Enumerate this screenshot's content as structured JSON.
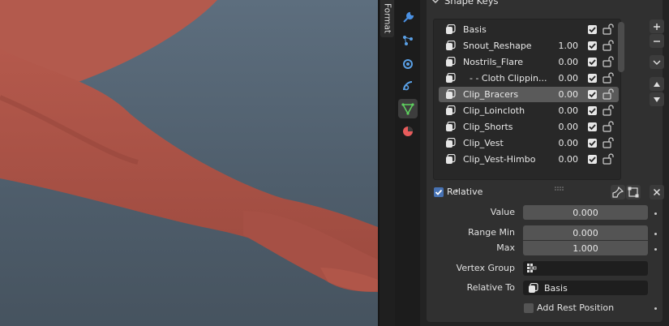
{
  "viewport": {
    "description_hidden": true
  },
  "format_tab": {
    "label": "Format"
  },
  "property_tabs": [
    {
      "icon": "wrench-icon",
      "color": "#4a90e2"
    },
    {
      "icon": "particles-icon",
      "color": "#5aa0e6"
    },
    {
      "icon": "physics-icon",
      "color": "#5aa0e6"
    },
    {
      "icon": "constraints-icon",
      "color": "#5aa0e6"
    },
    {
      "icon": "object-data-icon",
      "color": "#5fd05f",
      "active": true
    },
    {
      "icon": "material-icon",
      "color": "#e85c5c"
    }
  ],
  "panel": {
    "title": "Shape Keys"
  },
  "shape_keys": [
    {
      "name": "Basis",
      "value": ""
    },
    {
      "name": "Snout_Reshape",
      "value": "1.00"
    },
    {
      "name": "Nostrils_Flare",
      "value": "0.00"
    },
    {
      "name": "- - Cloth Clippin...",
      "value": "0.00"
    },
    {
      "name": "Clip_Bracers",
      "value": "0.00",
      "selected": true
    },
    {
      "name": "Clip_Loincloth",
      "value": "0.00"
    },
    {
      "name": "Clip_Shorts",
      "value": "0.00"
    },
    {
      "name": "Clip_Vest",
      "value": "0.00"
    },
    {
      "name": "Clip_Vest-Himbo",
      "value": "0.00"
    }
  ],
  "relative": {
    "label": "Relative",
    "checked": true
  },
  "properties": {
    "value_label": "Value",
    "value": "0.000",
    "range_min_label": "Range Min",
    "range_min": "0.000",
    "max_label": "Max",
    "max": "1.000",
    "vertex_group_label": "Vertex Group",
    "vertex_group": "",
    "relative_to_label": "Relative To",
    "relative_to": "Basis",
    "add_rest_label": "Add Rest Position",
    "add_rest_checked": false
  },
  "colors": {
    "accent": "#4772b3",
    "selected_row": "#5a5a5a"
  }
}
